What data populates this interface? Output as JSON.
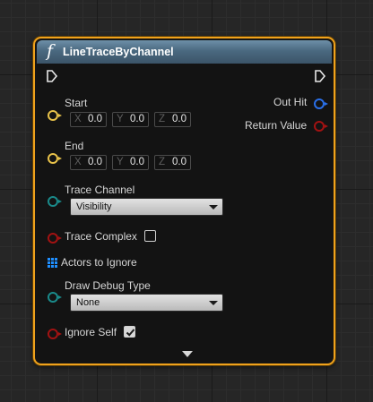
{
  "node": {
    "function_glyph": "f",
    "title": "LineTraceByChannel",
    "colors": {
      "border": "#f0a21c",
      "header": "#4a6980",
      "vector_pin": "#e8c24a",
      "name_pin": "#1a8a8a",
      "bool_pin": "#a21212",
      "struct_pin": "#2a6fe8"
    },
    "inputs": {
      "start": {
        "label": "Start",
        "x_axis": "X",
        "x": "0.0",
        "y_axis": "Y",
        "y": "0.0",
        "z_axis": "Z",
        "z": "0.0"
      },
      "end": {
        "label": "End",
        "x_axis": "X",
        "x": "0.0",
        "y_axis": "Y",
        "y": "0.0",
        "z_axis": "Z",
        "z": "0.0"
      },
      "trace_channel": {
        "label": "Trace Channel",
        "value": "Visibility"
      },
      "trace_complex": {
        "label": "Trace Complex",
        "checked": false
      },
      "actors_to_ignore": {
        "label": "Actors to Ignore",
        "icon": "array-grid-icon"
      },
      "draw_debug_type": {
        "label": "Draw Debug Type",
        "value": "None"
      },
      "ignore_self": {
        "label": "Ignore Self",
        "checked": true
      }
    },
    "outputs": {
      "out_hit": {
        "label": "Out Hit"
      },
      "return_value": {
        "label": "Return Value"
      }
    },
    "expand_icon": "chevron-down-icon"
  }
}
